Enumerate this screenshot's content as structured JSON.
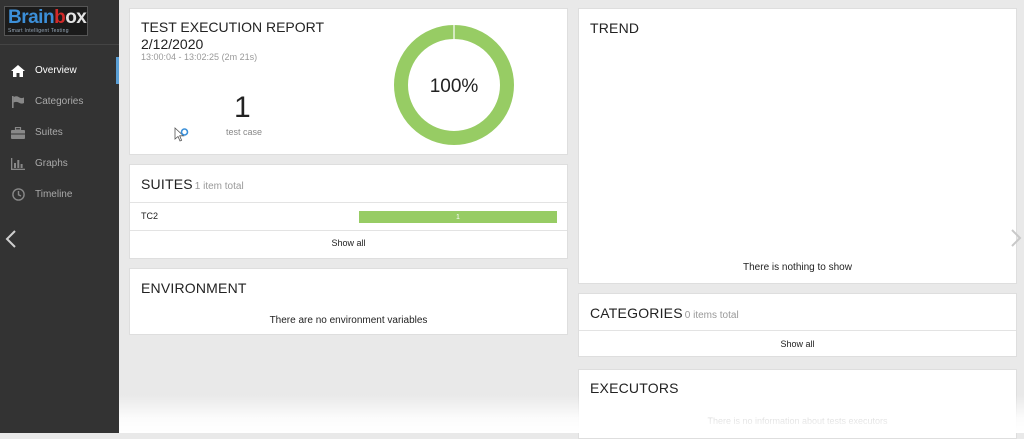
{
  "logo": {
    "part1": "Brain",
    "part2": "b",
    "part3": "ox",
    "tagline": "Smart Intelligent Testing"
  },
  "sidebar": {
    "items": [
      {
        "label": "Overview",
        "icon": "home-icon",
        "active": true
      },
      {
        "label": "Categories",
        "icon": "flag-icon",
        "active": false
      },
      {
        "label": "Suites",
        "icon": "briefcase-icon",
        "active": false
      },
      {
        "label": "Graphs",
        "icon": "bar-chart-icon",
        "active": false
      },
      {
        "label": "Timeline",
        "icon": "clock-icon",
        "active": false
      }
    ]
  },
  "report": {
    "title": "TEST EXECUTION REPORT",
    "date": "2/12/2020",
    "time_range": "13:00:04 - 13:02:25 (2m 21s)",
    "test_count": "1",
    "test_count_label": "test case",
    "success_rate": "100%",
    "pass_fraction": 1.0,
    "colors": {
      "passed": "#97cc64"
    }
  },
  "suites": {
    "title": "SUITES",
    "subtitle": "1 item total",
    "rows": [
      {
        "name": "TC2",
        "passed": "1",
        "passed_fraction": 1.0
      }
    ],
    "show_all": "Show all"
  },
  "environment": {
    "title": "ENVIRONMENT",
    "message": "There are no environment variables"
  },
  "trend": {
    "title": "TREND",
    "message": "There is nothing to show"
  },
  "categories": {
    "title": "CATEGORIES",
    "subtitle": "0 items total",
    "show_all": "Show all"
  },
  "executors": {
    "title": "EXECUTORS",
    "message": "There is no information about tests executors"
  }
}
